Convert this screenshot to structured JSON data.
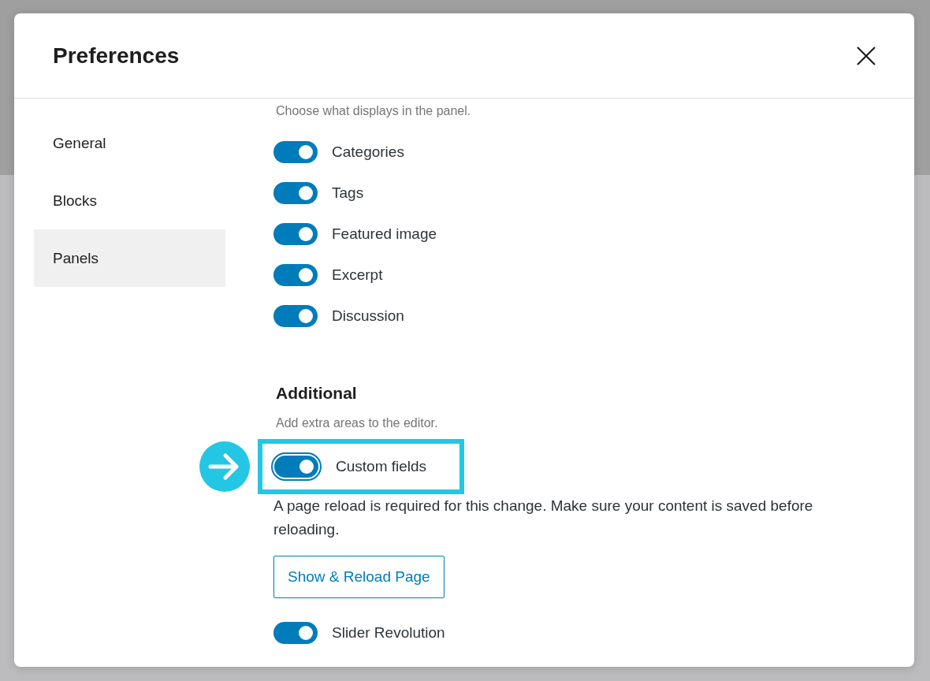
{
  "dialog": {
    "title": "Preferences"
  },
  "sidebar": {
    "items": [
      {
        "label": "General",
        "selected": false
      },
      {
        "label": "Blocks",
        "selected": false
      },
      {
        "label": "Panels",
        "selected": true
      }
    ]
  },
  "panel_options": {
    "description": "Choose what displays in the panel.",
    "toggles": [
      {
        "label": "Categories",
        "on": true
      },
      {
        "label": "Tags",
        "on": true
      },
      {
        "label": "Featured image",
        "on": true
      },
      {
        "label": "Excerpt",
        "on": true
      },
      {
        "label": "Discussion",
        "on": true
      }
    ]
  },
  "additional": {
    "heading": "Additional",
    "description": "Add extra areas to the editor.",
    "items": [
      {
        "kind": "toggle",
        "label": "Custom fields",
        "on": true,
        "focused": true,
        "highlighted": true
      },
      {
        "kind": "notice",
        "text": "A page reload is required for this change. Make sure your content is saved before reloading."
      },
      {
        "kind": "button",
        "label": "Show & Reload Page"
      },
      {
        "kind": "toggle",
        "label": "Slider Revolution",
        "on": true
      }
    ]
  }
}
